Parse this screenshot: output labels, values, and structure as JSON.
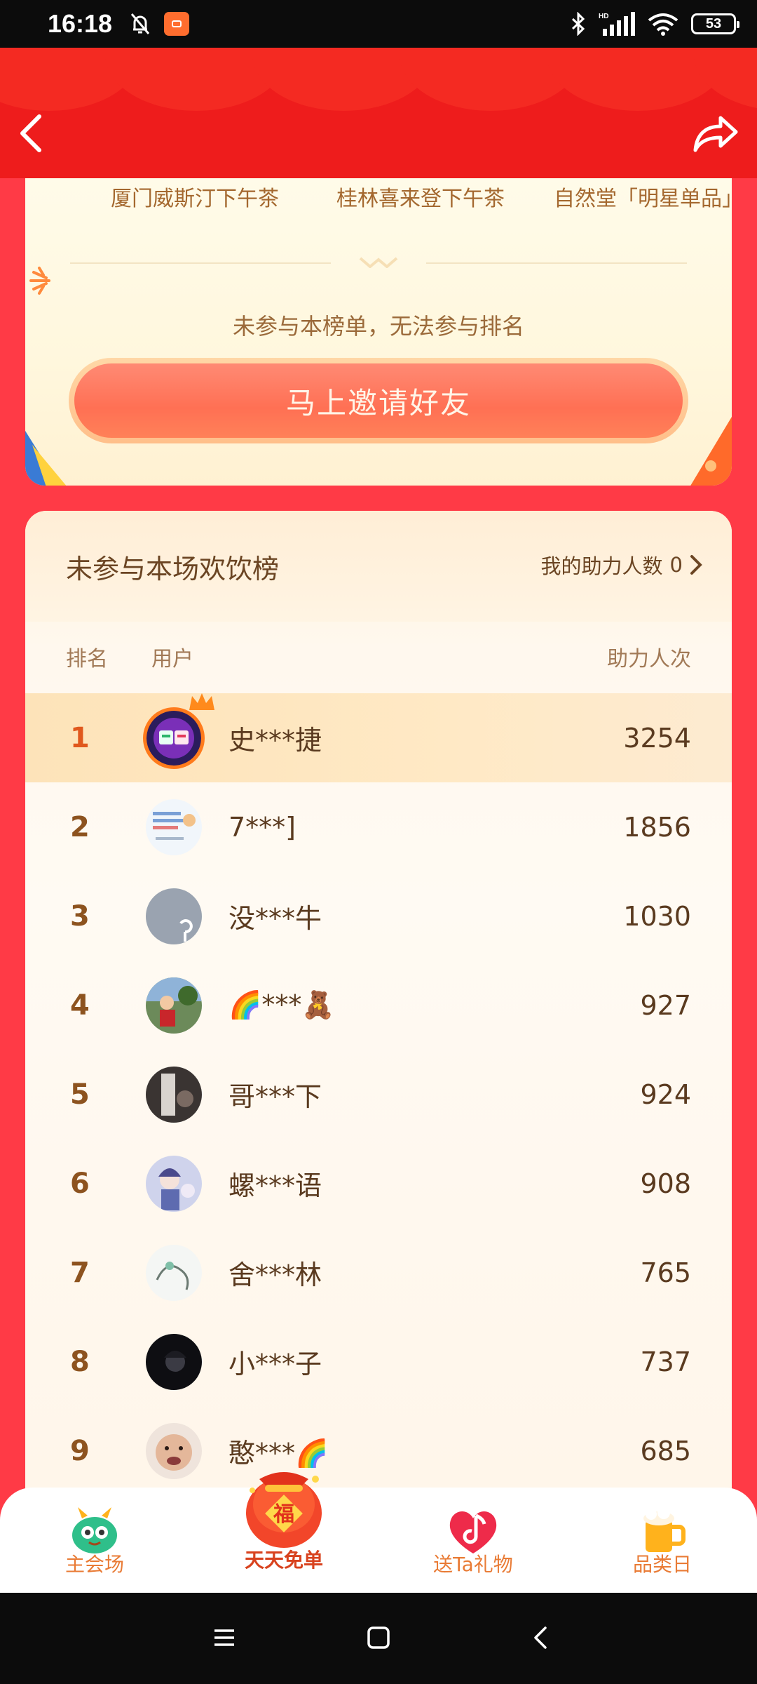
{
  "status_bar": {
    "time": "16:18",
    "battery": "53"
  },
  "top_card": {
    "tabs": [
      "厦门威斯汀下午茶",
      "桂林喜来登下午茶",
      "自然堂「明星单品」"
    ],
    "notice": "未参与本榜单，无法参与排名",
    "invite_button": "马上邀请好友"
  },
  "board": {
    "title": "未参与本场欢饮榜",
    "helper_label": "我的助力人数",
    "helper_count": "0",
    "columns": {
      "rank": "排名",
      "user": "用户",
      "count": "助力人次"
    },
    "rows": [
      {
        "rank": "1",
        "name": "史***捷",
        "count": "3254"
      },
      {
        "rank": "2",
        "name": "7***]",
        "count": "1856"
      },
      {
        "rank": "3",
        "name": "没***牛",
        "count": "1030"
      },
      {
        "rank": "4",
        "name": "🌈***🧸",
        "count": "927"
      },
      {
        "rank": "5",
        "name": "哥***下",
        "count": "924"
      },
      {
        "rank": "6",
        "name": "螺***语",
        "count": "908"
      },
      {
        "rank": "7",
        "name": "舍***林",
        "count": "765"
      },
      {
        "rank": "8",
        "name": "小***子",
        "count": "737"
      },
      {
        "rank": "9",
        "name": "憨***🌈",
        "count": "685"
      }
    ]
  },
  "tabbar": [
    {
      "label": "主会场"
    },
    {
      "label": "天天免单"
    },
    {
      "label": "送Ta礼物"
    },
    {
      "label": "品类日"
    }
  ],
  "colors": {
    "accent": "#ee1c1c",
    "page_bg": "#ff3a46",
    "gold_text": "#a4682f"
  }
}
